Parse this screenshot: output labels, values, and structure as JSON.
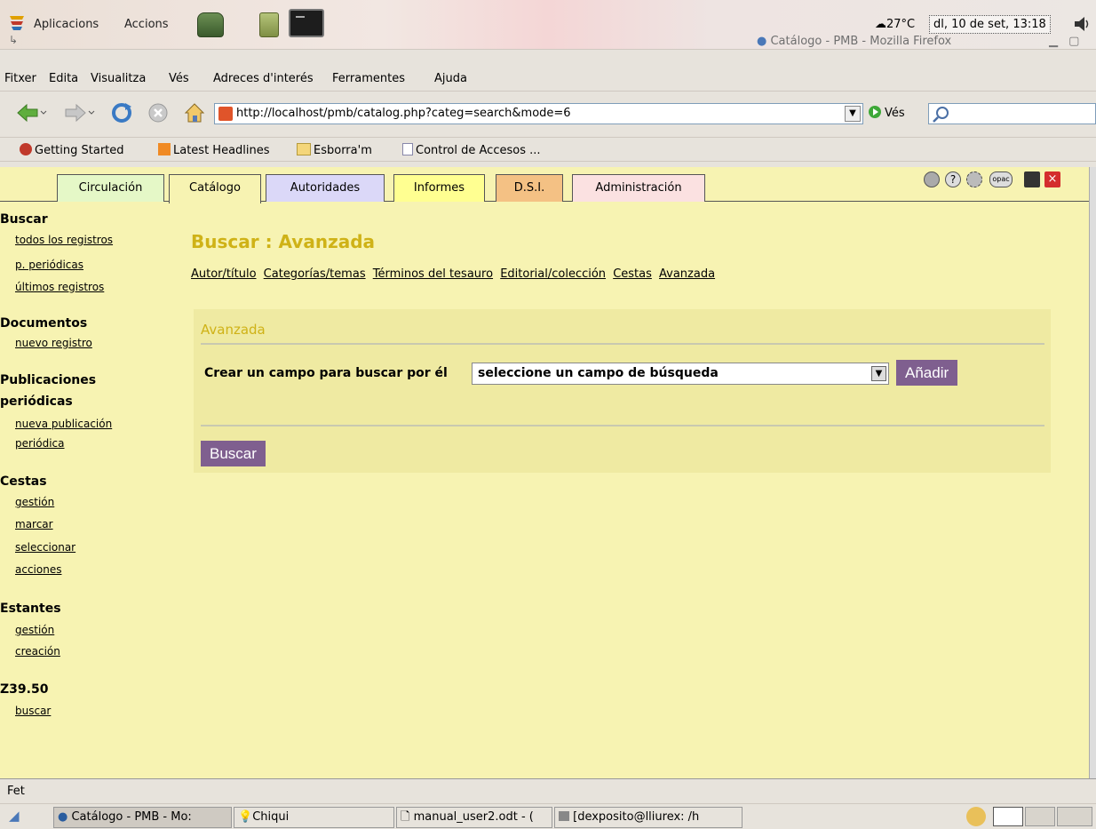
{
  "panel": {
    "apps": "Aplicacions",
    "actions": "Accions",
    "weather": "27°C",
    "clock": "dl, 10 de set, 13:18"
  },
  "window": {
    "title": "Catálogo - PMB - Mozilla Firefox"
  },
  "menubar": {
    "file": "Fitxer",
    "edit": "Edita",
    "view": "Visualitza",
    "go": "Vés",
    "bookmarks": "Adreces d'interés",
    "tools": "Ferramentes",
    "help": "Ajuda"
  },
  "toolbar": {
    "url": "http://localhost/pmb/catalog.php?categ=search&mode=6",
    "go_label": "Vés"
  },
  "bookmarks": [
    "Getting Started",
    "Latest Headlines",
    "Esborra'm",
    "Control de Accesos ..."
  ],
  "tabs": [
    {
      "label": "Circulación",
      "color": "#e5f8c7"
    },
    {
      "label": "Catálogo",
      "color": "#f7f3b2"
    },
    {
      "label": "Autoridades",
      "color": "#dbd8f8"
    },
    {
      "label": "Informes",
      "color": "#ffff91"
    },
    {
      "label": "D.S.I.",
      "color": "#f4c184"
    },
    {
      "label": "Administración",
      "color": "#fbe1e1"
    }
  ],
  "sidebar": {
    "search": {
      "title": "Buscar",
      "links": [
        "todos los registros",
        "p. periódicas",
        "últimos registros"
      ]
    },
    "documents": {
      "title": "Documentos",
      "links": [
        "nuevo registro"
      ]
    },
    "periodicals": {
      "title_line1": "Publicaciones",
      "title_line2": "periódicas",
      "links": [
        "nueva publicación",
        "periódica"
      ]
    },
    "baskets": {
      "title": "Cestas",
      "links": [
        "gestión",
        "marcar",
        "seleccionar",
        "acciones"
      ]
    },
    "shelves": {
      "title": "Estantes",
      "links": [
        "gestión",
        "creación"
      ]
    },
    "z3950": {
      "title": "Z39.50",
      "links": [
        "buscar"
      ]
    }
  },
  "main": {
    "title": "Buscar : Avanzada",
    "subnav": [
      "Autor/título",
      "Categorías/temas",
      "Términos del tesauro",
      "Editorial/colección",
      "Cestas",
      "Avanzada"
    ],
    "panel_title": "Avanzada",
    "field_label": "Crear un campo para buscar por él",
    "field_select": "seleccione un campo de búsqueda",
    "add_button": "Añadir",
    "search_button": "Buscar"
  },
  "status": "Fet",
  "taskbar": [
    "Catálogo - PMB - Mo:",
    "Chiqui",
    "manual_user2.odt - (",
    "[dexposito@lliurex: /h"
  ]
}
